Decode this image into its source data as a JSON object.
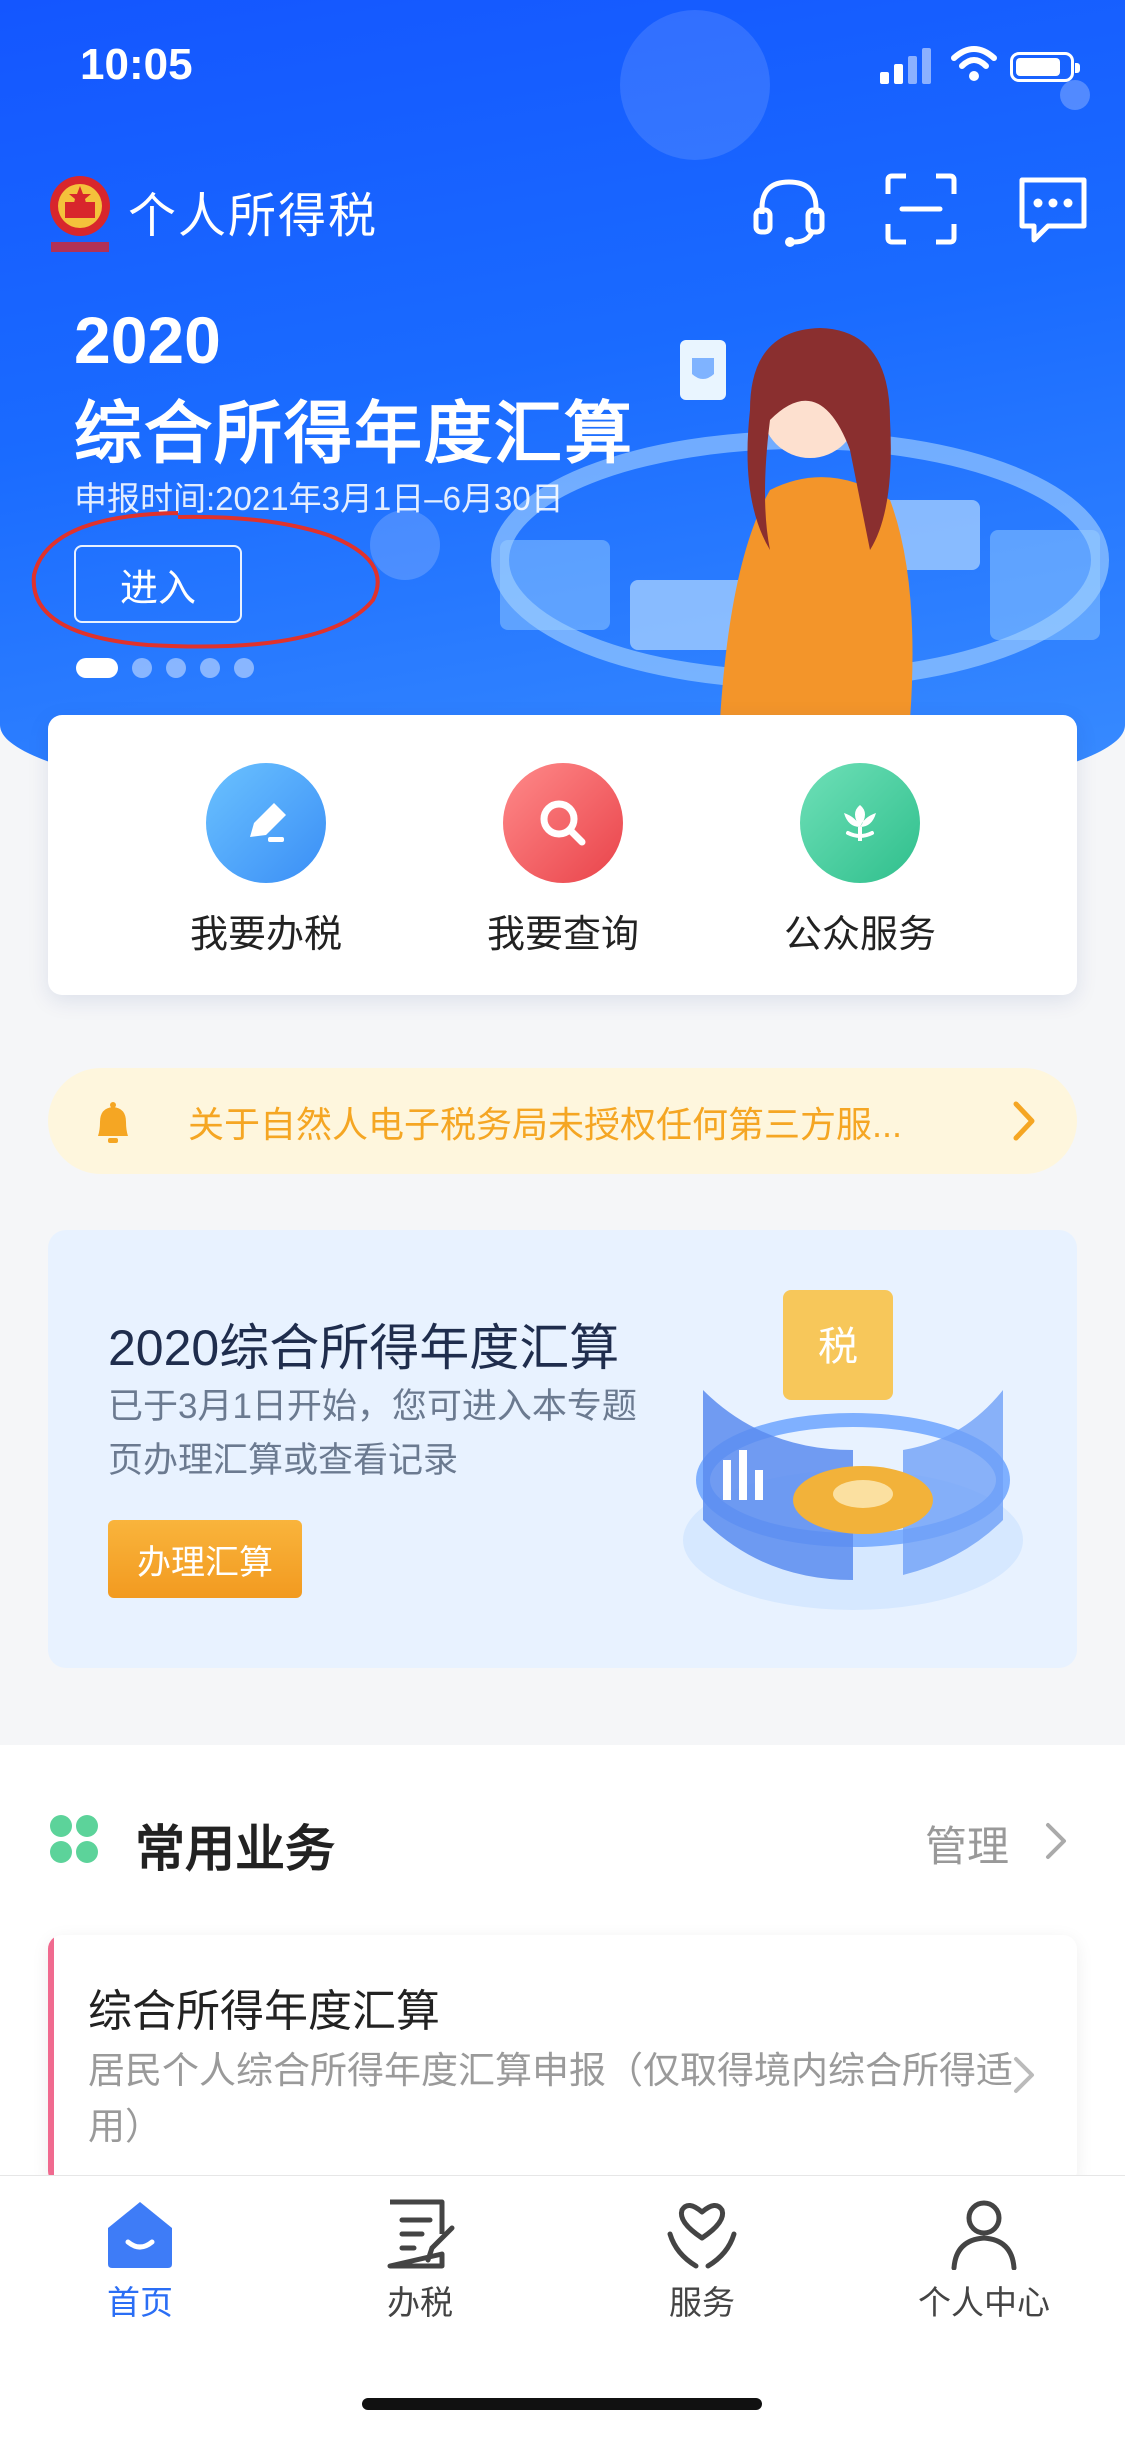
{
  "status_bar": {
    "time": "10:05"
  },
  "header": {
    "app_title": "个人所得税",
    "icons": [
      "headset-icon",
      "scan-icon",
      "message-icon"
    ]
  },
  "banner": {
    "year": "2020",
    "title": "综合所得年度汇算",
    "date": "申报时间:2021年3月1日–6月30日",
    "enter_label": "进入",
    "slide_count": 5,
    "active_slide": 1
  },
  "quick_actions": [
    {
      "label": "我要办税",
      "icon": "edit-icon",
      "color": "#4aa6f8"
    },
    {
      "label": "我要查询",
      "icon": "search-icon",
      "color": "#f05a5a"
    },
    {
      "label": "公众服务",
      "icon": "flower-icon",
      "color": "#3fcfa0"
    }
  ],
  "notice": {
    "text": "关于自然人电子税务局未授权任何第三方服...",
    "icon": "bell-icon"
  },
  "promo": {
    "title": "2020综合所得年度汇算",
    "desc": "已于3月1日开始，您可进入本专题页办理汇算或查看记录",
    "button_label": "办理汇算"
  },
  "common_services": {
    "title": "常用业务",
    "manage_label": "管理",
    "items": [
      {
        "title": "综合所得年度汇算",
        "desc": "居民个人综合所得年度汇算申报（仅取得境内综合所得适用）"
      }
    ]
  },
  "tabbar": {
    "items": [
      {
        "label": "首页",
        "icon": "home-icon",
        "active": true
      },
      {
        "label": "办税",
        "icon": "document-edit-icon",
        "active": false
      },
      {
        "label": "服务",
        "icon": "heart-hands-icon",
        "active": false
      },
      {
        "label": "个人中心",
        "icon": "user-icon",
        "active": false
      }
    ]
  },
  "colors": {
    "primary": "#1a6bff",
    "accent_orange": "#f29a20",
    "notice_text": "#f5a623",
    "active_tab": "#2a6ef5"
  }
}
